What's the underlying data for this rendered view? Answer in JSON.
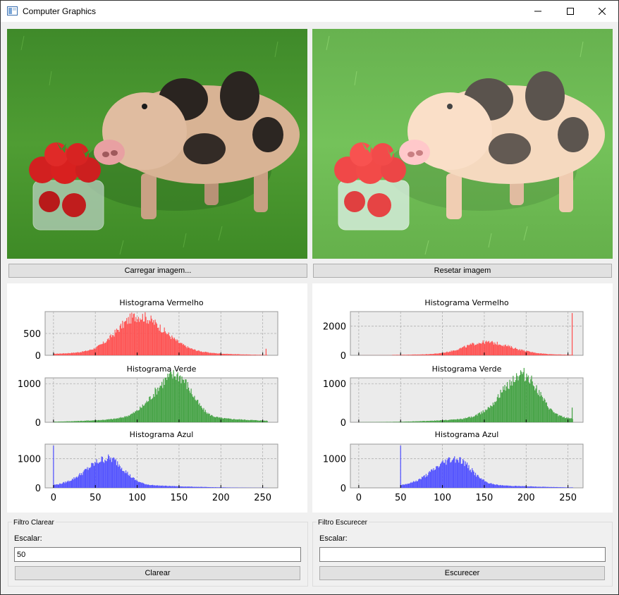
{
  "window": {
    "title": "Computer Graphics"
  },
  "buttons": {
    "load_image": "Carregar imagem...",
    "reset_image": "Resetar imagem",
    "brighten": "Clarear",
    "darken": "Escurecer"
  },
  "filters": {
    "brighten": {
      "title": "Filtro Clarear",
      "scale_label": "Escalar:",
      "scale_value": "50"
    },
    "darken": {
      "title": "Filtro Escurecer",
      "scale_label": "Escalar:",
      "scale_value": ""
    }
  },
  "chart_data": [
    {
      "type": "histogram",
      "panel": "left",
      "subplots": [
        {
          "title": "Histograma Vermelho",
          "color": "#ff4d4d",
          "ylim": [
            0,
            1000
          ],
          "yticks": [
            0,
            500
          ],
          "peaks": [
            {
              "x": 101,
              "y": 800
            }
          ],
          "spike_at": {
            "x": 254,
            "y": 150
          }
        },
        {
          "title": "Histograma Verde",
          "color": "#3fa03f",
          "ylim": [
            0,
            1150
          ],
          "yticks": [
            0,
            1000
          ],
          "peaks": [
            {
              "x": 146,
              "y": 1100
            }
          ],
          "spike_at": null
        },
        {
          "title": "Histograma Azul",
          "color": "#4d4dff",
          "ylim": [
            0,
            1500
          ],
          "yticks": [
            0,
            1000
          ],
          "peaks": [
            {
              "x": 65,
              "y": 900
            }
          ],
          "spike_at": {
            "x": 0,
            "y": 1450
          }
        }
      ],
      "xlim": [
        -10,
        268
      ],
      "xticks": [
        0,
        50,
        100,
        150,
        200,
        250
      ]
    },
    {
      "type": "histogram",
      "panel": "right",
      "subplots": [
        {
          "title": "Histograma Vermelho",
          "color": "#ff4d4d",
          "ylim": [
            0,
            3000
          ],
          "yticks": [
            0,
            2000
          ],
          "peaks": [
            {
              "x": 151,
              "y": 800
            }
          ],
          "spike_at": {
            "x": 255,
            "y": 2900
          }
        },
        {
          "title": "Histograma Verde",
          "color": "#3fa03f",
          "ylim": [
            0,
            1150
          ],
          "yticks": [
            0,
            1000
          ],
          "peaks": [
            {
              "x": 196,
              "y": 1100
            }
          ],
          "spike_at": {
            "x": 255,
            "y": 380
          }
        },
        {
          "title": "Histograma Azul",
          "color": "#4d4dff",
          "ylim": [
            0,
            1500
          ],
          "yticks": [
            0,
            1000
          ],
          "peaks": [
            {
              "x": 115,
              "y": 900
            }
          ],
          "spike_at": {
            "x": 50,
            "y": 1450
          }
        }
      ],
      "xlim": [
        -10,
        268
      ],
      "xticks": [
        0,
        50,
        100,
        150,
        200,
        250
      ]
    }
  ]
}
